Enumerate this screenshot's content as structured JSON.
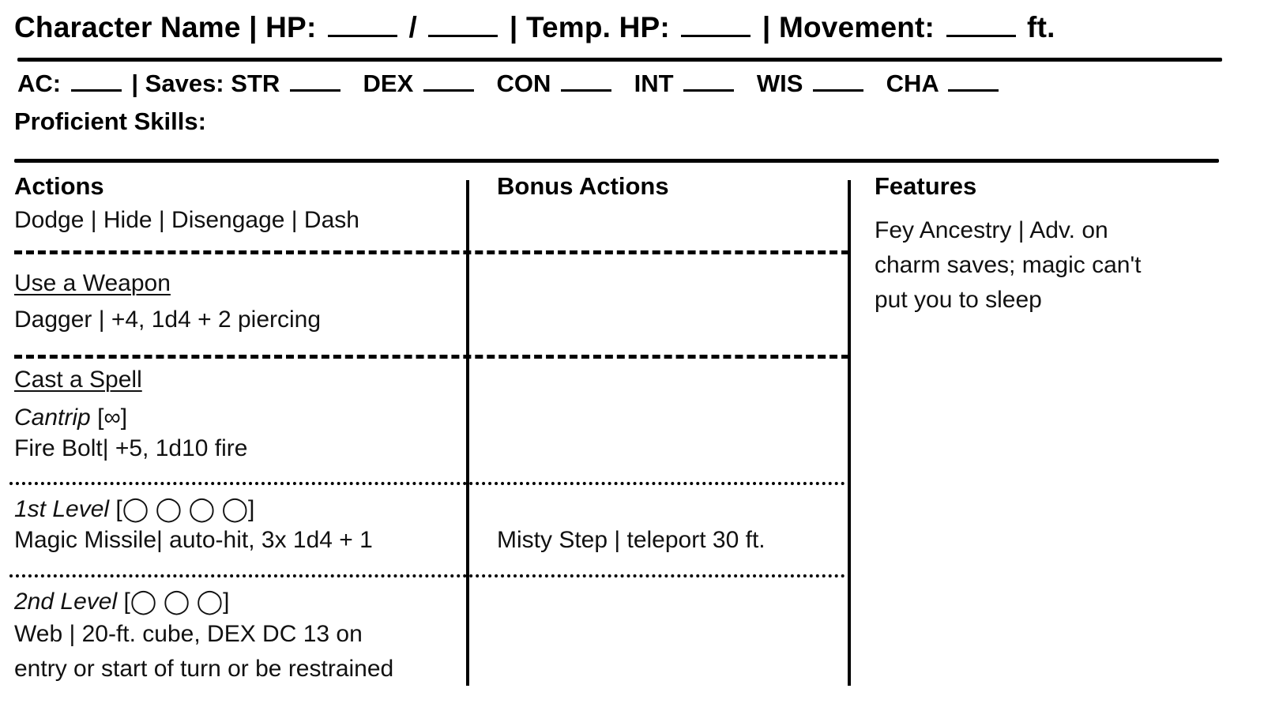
{
  "header": {
    "character_name_label": "Character Name",
    "sep": "|",
    "hp_label": "HP:",
    "hp_current": "",
    "hp_slash": "/",
    "hp_max": "",
    "temp_hp_label": "Temp. HP:",
    "temp_hp": "",
    "movement_label": "Movement:",
    "movement": "",
    "movement_unit": "ft."
  },
  "stats": {
    "ac_label": "AC:",
    "ac": "",
    "saves_label": "Saves:",
    "saves": [
      {
        "label": "STR",
        "value": ""
      },
      {
        "label": "DEX",
        "value": ""
      },
      {
        "label": "CON",
        "value": ""
      },
      {
        "label": "INT",
        "value": ""
      },
      {
        "label": "WIS",
        "value": ""
      },
      {
        "label": "CHA",
        "value": ""
      }
    ],
    "proficient_skills_label": "Proficient Skills:",
    "proficient_skills": ""
  },
  "actions": {
    "title": "Actions",
    "basic": "Dodge | Hide | Disengage | Dash",
    "weapon_heading": "Use a Weapon",
    "weapon": "Dagger | +4, 1d4 + 2 piercing",
    "spell_heading": "Cast a Spell",
    "cantrip_label": "Cantrip",
    "cantrip_slots": "[∞]",
    "cantrip_spell": "Fire Bolt| +5, 1d10 fire",
    "level1_label": "1st Level",
    "level1_slots": "[◯ ◯ ◯ ◯]",
    "level1_spell": "Magic Missile| auto-hit, 3x 1d4 + 1",
    "level2_label": "2nd Level",
    "level2_slots": "[◯ ◯ ◯]",
    "level2_spell_line1": "Web | 20-ft. cube, DEX DC 13 on",
    "level2_spell_line2": "entry or start of turn or be restrained"
  },
  "bonus_actions": {
    "title": "Bonus Actions",
    "level1_spell": "Misty Step | teleport 30 ft."
  },
  "features": {
    "title": "Features",
    "line1": "Fey Ancestry | Adv. on",
    "line2": "charm saves; magic can't",
    "line3": "put you to sleep"
  }
}
